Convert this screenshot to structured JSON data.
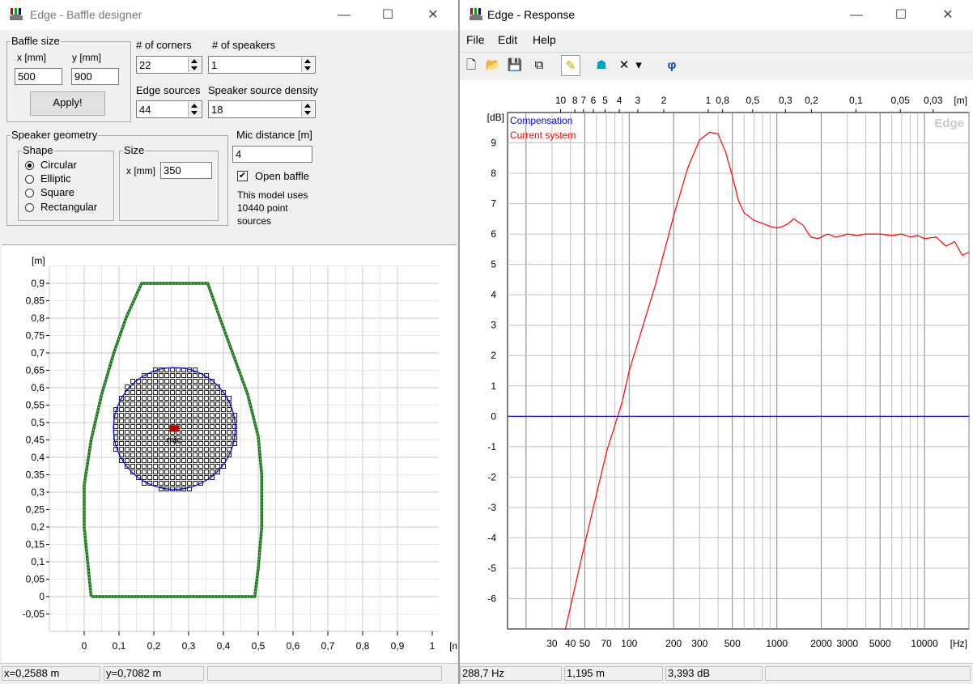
{
  "baffle_window": {
    "title": "Edge - Baffle designer",
    "controls": {
      "minimize": "—",
      "maximize": "☐",
      "close": "✕"
    },
    "baffle_size": {
      "group_label": "Baffle size",
      "x_label": "x [mm]",
      "y_label": "y [mm]",
      "x_value": "500",
      "y_value": "900",
      "apply_label": "Apply!"
    },
    "corners": {
      "label": "# of corners",
      "value": "22"
    },
    "speakers": {
      "label": "# of speakers",
      "value": "1"
    },
    "edge_sources": {
      "label": "Edge sources",
      "value": "44"
    },
    "speaker_density": {
      "label": "Speaker source density",
      "value": "18"
    },
    "speaker_geometry": {
      "group_label": "Speaker geometry",
      "shape_label": "Shape",
      "shapes": [
        "Circular",
        "Elliptic",
        "Square",
        "Rectangular"
      ],
      "selected_shape": "Circular",
      "size_label": "Size",
      "size_x_label": "x [mm]",
      "size_x_value": "350"
    },
    "mic_distance": {
      "label": "Mic distance [m]",
      "value": "4"
    },
    "open_baffle": {
      "label": "Open baffle",
      "checked": true
    },
    "model_info": {
      "line1": "This model uses",
      "line2": "10440 point",
      "line3": "sources"
    },
    "status": {
      "x": "x=0,2588 m",
      "y": "y=0,7082 m"
    }
  },
  "response_window": {
    "title": "Edge - Response",
    "controls": {
      "minimize": "—",
      "maximize": "☐",
      "close": "✕"
    },
    "menu": [
      "File",
      "Edit",
      "Help"
    ],
    "toolbar": [
      {
        "name": "new-icon",
        "glyph": "🗋"
      },
      {
        "name": "open-folder-icon",
        "glyph": "📂"
      },
      {
        "name": "save-icon",
        "glyph": "💾"
      },
      {
        "name": "copy-icon",
        "glyph": "⧉"
      },
      {
        "name": "pencil-icon",
        "glyph": "✎"
      },
      {
        "name": "plot-icon",
        "glyph": "☗"
      },
      {
        "name": "delete-icon",
        "glyph": "✕"
      },
      {
        "name": "dropdown-arrow-icon",
        "glyph": "▾"
      },
      {
        "name": "phase-icon",
        "glyph": "φ"
      }
    ],
    "status": {
      "freq": "288,7 Hz",
      "wavelength": "1,195 m",
      "level": "3,393 dB"
    }
  },
  "chart_data": [
    {
      "type": "scatter",
      "title": "",
      "xlabel": "[m]",
      "ylabel": "[m]",
      "xlim": [
        -0.1,
        1.05
      ],
      "ylim": [
        -0.1,
        0.98
      ],
      "x_ticks": [
        "0",
        "0,1",
        "0,2",
        "0,3",
        "0,4",
        "0,5",
        "0,6",
        "0,7",
        "0,8",
        "0,9",
        "1"
      ],
      "y_ticks": [
        "-0,05",
        "0",
        "0,05",
        "0,1",
        "0,15",
        "0,2",
        "0,25",
        "0,3",
        "0,35",
        "0,4",
        "0,45",
        "0,5",
        "0,55",
        "0,6",
        "0,65",
        "0,7",
        "0,75",
        "0,8",
        "0,85",
        "0,9"
      ],
      "grid": true,
      "baffle_outline": [
        [
          0.02,
          0
        ],
        [
          0.49,
          0
        ],
        [
          0.5,
          0.08
        ],
        [
          0.51,
          0.2
        ],
        [
          0.51,
          0.35
        ],
        [
          0.5,
          0.46
        ],
        [
          0.47,
          0.58
        ],
        [
          0.43,
          0.69
        ],
        [
          0.39,
          0.8
        ],
        [
          0.355,
          0.9
        ],
        [
          0.165,
          0.9
        ],
        [
          0.12,
          0.8
        ],
        [
          0.085,
          0.7
        ],
        [
          0.05,
          0.58
        ],
        [
          0.02,
          0.45
        ],
        [
          0.0,
          0.32
        ],
        [
          0.0,
          0.2
        ],
        [
          0.01,
          0.1
        ],
        [
          0.02,
          0
        ]
      ],
      "speaker": {
        "center": [
          0.259,
          0.483
        ],
        "radius": 0.175
      },
      "mic": {
        "position": [
          0.259,
          0.483
        ],
        "label": "mic"
      },
      "colors": {
        "outline": "#1a7a1a",
        "speaker": "#0000ff",
        "mic": "#b00000"
      }
    },
    {
      "type": "line",
      "title": "",
      "xlabel": "[Hz]",
      "ylabel": "[dB]",
      "xscale": "log",
      "xlim": [
        15,
        20000
      ],
      "ylim": [
        -7,
        10
      ],
      "grid": true,
      "top_axis_label": "[m]",
      "top_ticks": [
        "10",
        "8",
        "7",
        "6",
        "5",
        "4",
        "3",
        "2",
        "1",
        "0,8",
        "0,5",
        "0,3",
        "0,2",
        "0,1",
        "0,05",
        "0,03"
      ],
      "x_ticks": [
        "30",
        "40",
        "50",
        "70",
        "100",
        "200",
        "300",
        "500",
        "1000",
        "2000",
        "3000",
        "5000",
        "10000"
      ],
      "y_ticks": [
        "9",
        "8",
        "7",
        "6",
        "5",
        "4",
        "3",
        "2",
        "1",
        "0",
        "-1",
        "-2",
        "-3",
        "-4",
        "-5",
        "-6"
      ],
      "watermark": "Edge",
      "legend": {
        "placement": "top-left"
      },
      "series": [
        {
          "name": "Compensation",
          "color": "#0000ff",
          "x": [
            15,
            20000
          ],
          "y": [
            0,
            0
          ]
        },
        {
          "name": "Current system",
          "color": "#ff0000",
          "x": [
            37,
            50,
            70,
            90,
            100,
            150,
            200,
            250,
            300,
            350,
            400,
            450,
            500,
            550,
            600,
            700,
            800,
            900,
            1000,
            1100,
            1200,
            1300,
            1500,
            1700,
            1900,
            2000,
            2200,
            2500,
            2800,
            3000,
            3500,
            4000,
            5000,
            6000,
            7000,
            8000,
            9000,
            10000,
            12000,
            14000,
            16000,
            18000,
            20000
          ],
          "y": [
            -7,
            -4.2,
            -1.2,
            0.5,
            1.5,
            4.3,
            6.6,
            8.2,
            9.1,
            9.35,
            9.3,
            8.7,
            7.9,
            7.1,
            6.7,
            6.45,
            6.35,
            6.25,
            6.2,
            6.25,
            6.35,
            6.5,
            6.3,
            5.9,
            5.85,
            5.9,
            6.0,
            5.9,
            5.95,
            6.0,
            5.95,
            6.0,
            6.0,
            5.95,
            6.0,
            5.9,
            5.95,
            5.85,
            5.9,
            5.6,
            5.75,
            5.3,
            5.4
          ]
        }
      ]
    }
  ]
}
